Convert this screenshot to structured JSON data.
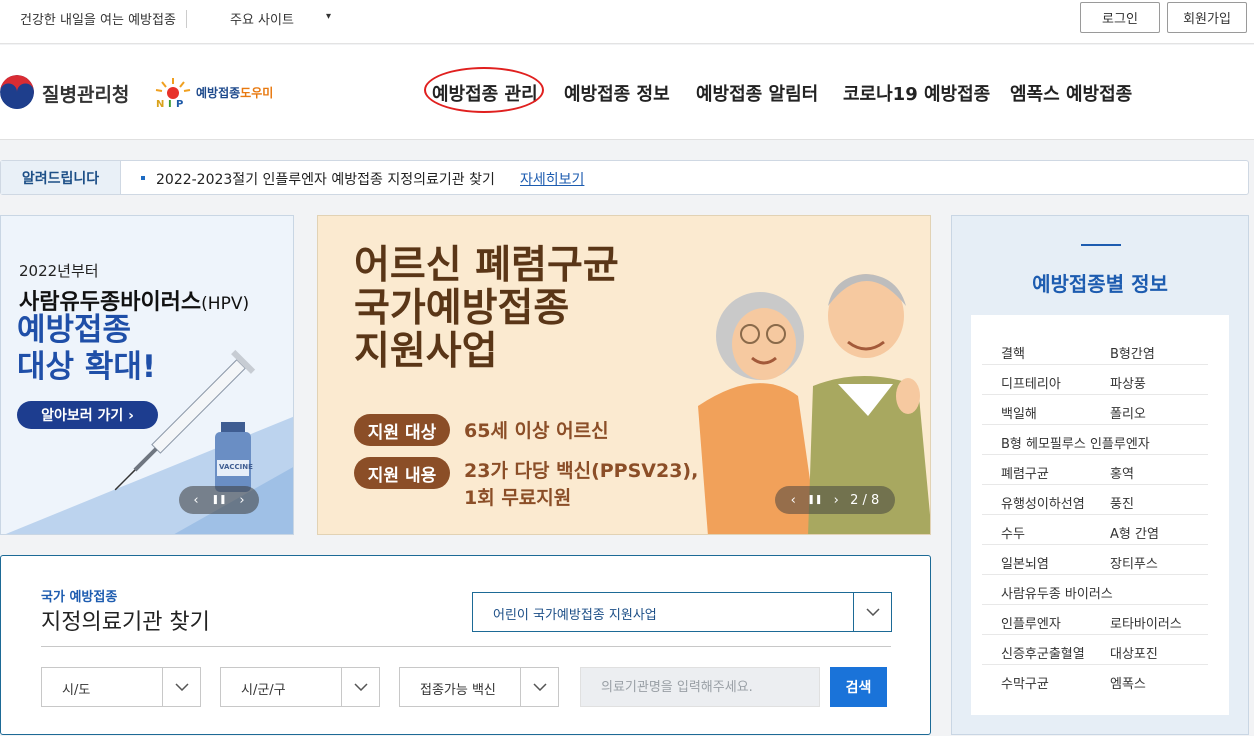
{
  "util": {
    "slogan": "건강한 내일을 여는 예방접종",
    "sites_label": "주요 사이트",
    "caret": "▾",
    "login": "로그인",
    "join": "회원가입"
  },
  "header": {
    "org_name": "질병관리청",
    "nip_name_main": "예방접종",
    "nip_name_accent": "도우미",
    "nav": [
      {
        "label": "예방접종 관리"
      },
      {
        "label": "예방접종 정보"
      },
      {
        "label": "예방접종 알림터"
      },
      {
        "label": "코로나19 예방접종"
      },
      {
        "label": "엠폭스 예방접종"
      }
    ]
  },
  "notice": {
    "label": "알려드립니다",
    "text": "2022-2023절기 인플루엔자 예방접종 지정의료기관 찾기",
    "link": "자세히보기"
  },
  "hpv_banner": {
    "small": "2022년부터",
    "title": "사람유두종바이러스",
    "title_sub": "(HPV)",
    "big_line1": "예방접종",
    "big_line2": "대상 확대!",
    "button": "알아보러 가기  ›",
    "vial_label": "VACCINE",
    "ctrl_prev": "‹",
    "ctrl_pause": "❚❚",
    "ctrl_next": "›"
  },
  "senior_banner": {
    "title_line1": "어르신 폐렴구균",
    "title_line2": "국가예방접종",
    "title_line3": "지원사업",
    "pill1": "지원 대상",
    "value1": "65세 이상 어르신",
    "pill2": "지원 내용",
    "value2_line1": "23가 다당 백신(PPSV23),",
    "value2_line2": "1회 무료지원",
    "ctrl_prev": "‹",
    "ctrl_pause": "❚❚",
    "ctrl_next": "›",
    "page": "2 / 8"
  },
  "vaccine_panel": {
    "title": "예방접종별 정보",
    "rows": [
      [
        "결핵",
        "B형간염"
      ],
      [
        "디프테리아",
        "파상풍"
      ],
      [
        "백일해",
        "폴리오"
      ],
      [
        "B형 헤모필루스 인플루엔자",
        ""
      ],
      [
        "폐렴구균",
        "홍역"
      ],
      [
        "유행성이하선염",
        "풍진"
      ],
      [
        "수두",
        "A형 간염"
      ],
      [
        "일본뇌염",
        "장티푸스"
      ],
      [
        "사람유두종 바이러스",
        ""
      ],
      [
        "인플루엔자",
        "로타바이러스"
      ],
      [
        "신증후군출혈열",
        "대상포진"
      ],
      [
        "수막구균",
        "엠폭스"
      ]
    ]
  },
  "search": {
    "kicker": "국가 예방접종",
    "title": "지정의료기관 찾기",
    "program": "어린이 국가예방접종 지원사업",
    "sido": "시/도",
    "sigungu": "시/군/구",
    "vaccine": "접종가능 백신",
    "placeholder": "의료기관명을 입력해주세요.",
    "button": "검색"
  },
  "colors": {
    "brand_blue": "#1d5cb0",
    "notice_bg": "#e9f0f7",
    "banner_brown": "#8b4e27",
    "search_btn": "#1a73d9",
    "highlight_circle": "#e0201f"
  }
}
